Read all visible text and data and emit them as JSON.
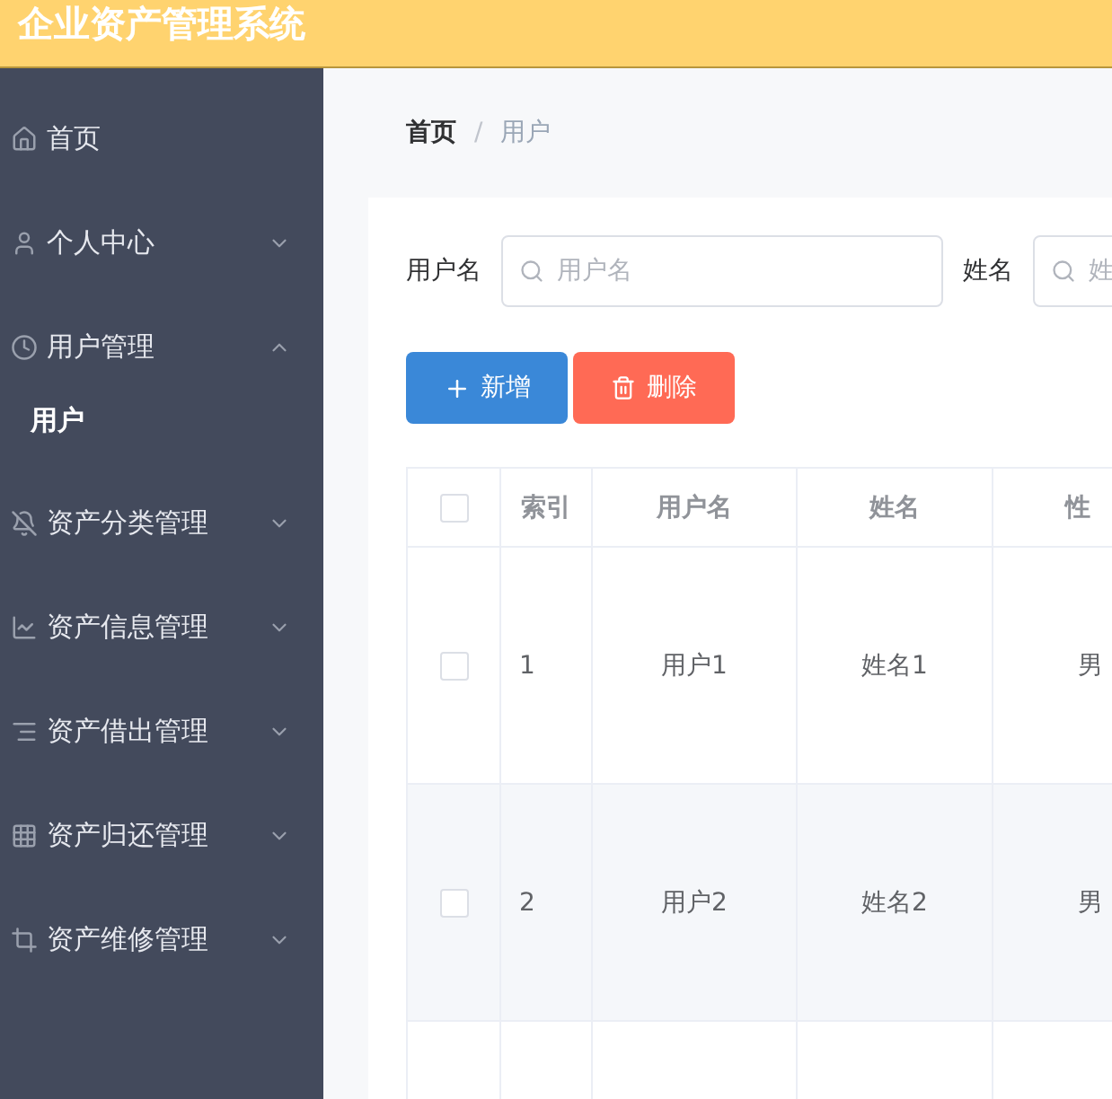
{
  "header": {
    "title": "企业资产管理系统"
  },
  "sidebar": {
    "items": [
      {
        "label": "首页",
        "kind": "link"
      },
      {
        "label": "个人中心",
        "kind": "submenu",
        "expanded": false
      },
      {
        "label": "用户管理",
        "kind": "submenu",
        "expanded": true,
        "children": [
          {
            "label": "用户",
            "selected": true
          }
        ]
      },
      {
        "label": "资产分类管理",
        "kind": "submenu",
        "expanded": false
      },
      {
        "label": "资产信息管理",
        "kind": "submenu",
        "expanded": false
      },
      {
        "label": "资产借出管理",
        "kind": "submenu",
        "expanded": false
      },
      {
        "label": "资产归还管理",
        "kind": "submenu",
        "expanded": false
      },
      {
        "label": "资产维修管理",
        "kind": "submenu",
        "expanded": false
      }
    ]
  },
  "breadcrumb": {
    "separator": "/",
    "items": [
      "首页",
      "用户"
    ]
  },
  "search": [
    {
      "label": "用户名",
      "placeholder": "用户名"
    },
    {
      "label": "姓名",
      "placeholder": "姓"
    }
  ],
  "buttons": [
    {
      "label": "新增",
      "kind": "add"
    },
    {
      "label": "删除",
      "kind": "delete"
    }
  ],
  "table": {
    "select_all": {
      "checked": false
    },
    "columns": [
      "索引",
      "用户名",
      "姓名",
      "性"
    ],
    "rows": [
      {
        "checked": false,
        "cells": [
          "1",
          "用户1",
          "姓名1",
          "男"
        ]
      },
      {
        "checked": false,
        "cells": [
          "2",
          "用户2",
          "姓名2",
          "男"
        ]
      },
      {
        "cells": []
      }
    ]
  }
}
